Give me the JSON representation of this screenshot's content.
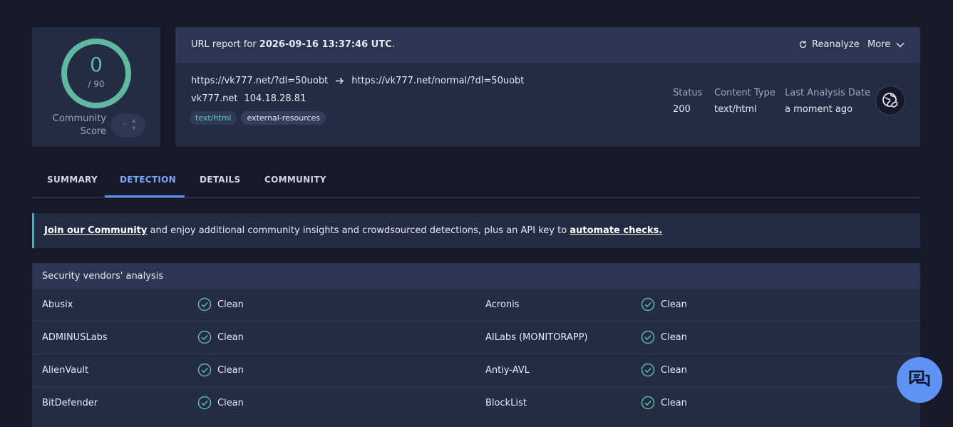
{
  "score": {
    "value": "0",
    "total": "/ 90",
    "community_label": "Community Score",
    "community_value": "-"
  },
  "report": {
    "title_prefix": "URL report for ",
    "title_date": "2026-09-16 13:37:46 UTC",
    "title_suffix": ".",
    "reanalyze_label": "Reanalyze",
    "more_label": "More",
    "url_from": "https://vk777.net/?dl=50uobt",
    "url_to": "https://vk777.net/normal/?dl=50uobt",
    "host": "vk777.net",
    "ip": "104.18.28.81",
    "tags": [
      "text/html",
      "external-resources"
    ],
    "meta": [
      {
        "key": "Status",
        "value": "200"
      },
      {
        "key": "Content Type",
        "value": "text/html"
      },
      {
        "key": "Last Analysis Date",
        "value": "a moment ago"
      }
    ]
  },
  "tabs": [
    "SUMMARY",
    "DETECTION",
    "DETAILS",
    "COMMUNITY"
  ],
  "active_tab": "DETECTION",
  "banner": {
    "link1": "Join our Community",
    "middle": " and enjoy additional community insights and crowdsourced detections, plus an API key to ",
    "link2": "automate checks."
  },
  "vendors": {
    "title": "Security vendors' analysis",
    "rows": [
      [
        {
          "name": "Abusix",
          "result": "Clean"
        },
        {
          "name": "Acronis",
          "result": "Clean"
        }
      ],
      [
        {
          "name": "ADMINUSLabs",
          "result": "Clean"
        },
        {
          "name": "AILabs (MONITORAPP)",
          "result": "Clean"
        }
      ],
      [
        {
          "name": "AlienVault",
          "result": "Clean"
        },
        {
          "name": "Antiy-AVL",
          "result": "Clean"
        }
      ],
      [
        {
          "name": "BitDefender",
          "result": "Clean"
        },
        {
          "name": "BlockList",
          "result": "Clean"
        }
      ]
    ]
  },
  "colors": {
    "accent": "#5d8df7",
    "clean": "#5fb8a0",
    "banner_border": "#39b3d0"
  },
  "icons": [
    "refresh-icon",
    "chevron-down-icon",
    "arrow-right-icon",
    "globe-link-icon",
    "check-circle-icon",
    "chat-icon"
  ]
}
